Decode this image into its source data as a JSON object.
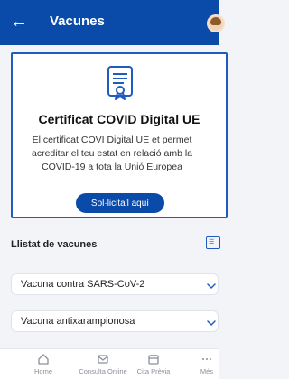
{
  "header": {
    "title": "Vacunes",
    "back_icon": "arrow-left-icon"
  },
  "certificate": {
    "title": "Certificat COVID Digital UE",
    "description": "El certificat COVI Digital UE et permet acreditar el teu estat en relació amb la COVID-19 a tota la Unió Europea",
    "button_label": "Sol·licita'l aquí",
    "icon": "certificate-icon",
    "accent": "#1f5bc1"
  },
  "vaccines_section": {
    "title": "Llistat de vacunes",
    "items": [
      {
        "label": "Vacuna contra SARS-CoV-2"
      },
      {
        "label": "Vacuna antixarampionosa"
      }
    ]
  },
  "bottom_nav": {
    "items": [
      {
        "label": "Home",
        "icon": "home-icon"
      },
      {
        "label": "Consulta Online",
        "icon": "mail-icon"
      },
      {
        "label": "Cita Prèvia",
        "icon": "calendar-icon"
      },
      {
        "label": "Més",
        "icon": "more-icon"
      }
    ]
  },
  "colors": {
    "primary": "#0a4aa8",
    "background": "#f3f4f7"
  }
}
